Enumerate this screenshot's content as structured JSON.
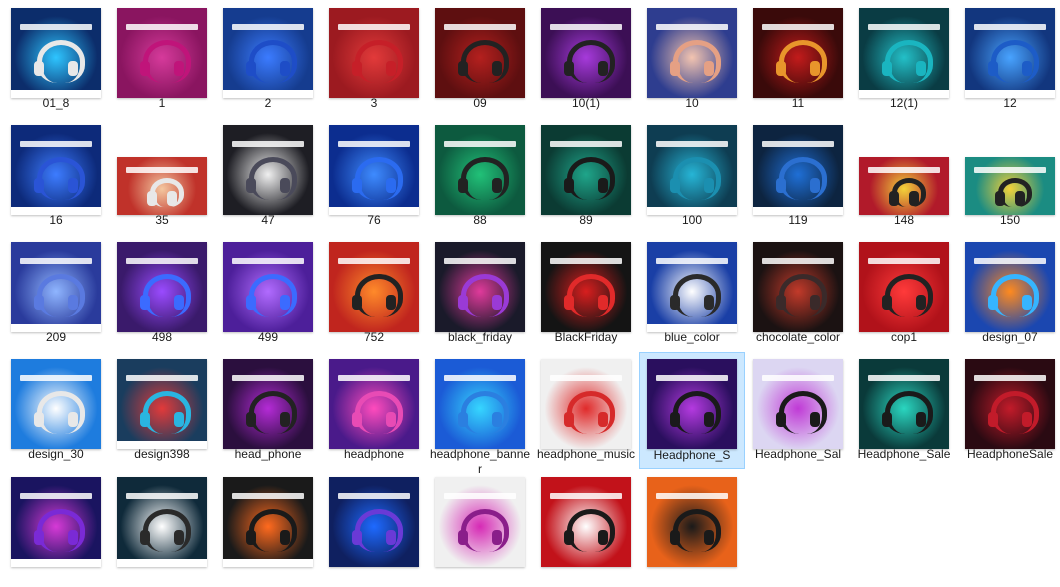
{
  "selected": "Headphone_S",
  "files": [
    {
      "name": "01_8",
      "bg": "#0c2d6b",
      "accent": "#2ec5ff",
      "hp": "#e8e8e8",
      "footer": true,
      "w": 90,
      "h": 90
    },
    {
      "name": "1",
      "bg": "#8a1560",
      "accent": "#d63a9b",
      "hp": "#c0147a",
      "footer": false,
      "w": 90,
      "h": 90
    },
    {
      "name": "2",
      "bg": "#153c8f",
      "accent": "#3b7bff",
      "hp": "#1e4dc7",
      "footer": true,
      "w": 90,
      "h": 90
    },
    {
      "name": "3",
      "bg": "#9c1a20",
      "accent": "#e23a3a",
      "hp": "#c61f28",
      "footer": false,
      "w": 90,
      "h": 90
    },
    {
      "name": "09",
      "bg": "#5e0f10",
      "accent": "#b4201e",
      "hp": "#222222",
      "footer": false,
      "w": 90,
      "h": 90
    },
    {
      "name": "10(1)",
      "bg": "#3c0f55",
      "accent": "#a63adb",
      "hp": "#222222",
      "footer": false,
      "w": 90,
      "h": 90
    },
    {
      "name": "10",
      "bg": "#2e3d8f",
      "accent": "#f3c4b0",
      "hp": "#e5a084",
      "footer": false,
      "w": 90,
      "h": 90
    },
    {
      "name": "11",
      "bg": "#3a0a0a",
      "accent": "#c21b1b",
      "hp": "#e8952b",
      "footer": false,
      "w": 90,
      "h": 90
    },
    {
      "name": "12(1)",
      "bg": "#0a3c44",
      "accent": "#23c0c8",
      "hp": "#1ab5c0",
      "footer": true,
      "w": 90,
      "h": 90
    },
    {
      "name": "12",
      "bg": "#12367e",
      "accent": "#48a3ff",
      "hp": "#1d5cc7",
      "footer": true,
      "w": 90,
      "h": 90
    },
    {
      "name": "16",
      "bg": "#0d2a7a",
      "accent": "#3d7cff",
      "hp": "#2a54d6",
      "footer": true,
      "w": 90,
      "h": 90
    },
    {
      "name": "35",
      "bg": "#c0322a",
      "accent": "#f4c7a0",
      "hp": "#e8e8e8",
      "footer": false,
      "w": 90,
      "h": 58
    },
    {
      "name": "47",
      "bg": "#1e1e24",
      "accent": "#f0f0f0",
      "hp": "#4a4a5a",
      "footer": false,
      "w": 90,
      "h": 90
    },
    {
      "name": "76",
      "bg": "#0c2d8f",
      "accent": "#3e8bff",
      "hp": "#2b6bf0",
      "footer": true,
      "w": 90,
      "h": 90
    },
    {
      "name": "88",
      "bg": "#0d5a3f",
      "accent": "#21c178",
      "hp": "#222222",
      "footer": false,
      "w": 90,
      "h": 90
    },
    {
      "name": "89",
      "bg": "#0b3b33",
      "accent": "#1fa58a",
      "hp": "#1a1a1a",
      "footer": false,
      "w": 90,
      "h": 90
    },
    {
      "name": "100",
      "bg": "#0e3d52",
      "accent": "#26b5d6",
      "hp": "#1b8fb0",
      "footer": true,
      "w": 90,
      "h": 90
    },
    {
      "name": "119",
      "bg": "#0d2440",
      "accent": "#1f6fd6",
      "hp": "#2b6fd0",
      "footer": true,
      "w": 90,
      "h": 90
    },
    {
      "name": "148",
      "bg": "#b11a2a",
      "accent": "#f3d23a",
      "hp": "#222222",
      "footer": false,
      "w": 90,
      "h": 58
    },
    {
      "name": "150",
      "bg": "#1b8c82",
      "accent": "#f3d23a",
      "hp": "#222222",
      "footer": false,
      "w": 90,
      "h": 58
    },
    {
      "name": "209",
      "bg": "#2a3b9c",
      "accent": "#8fb5ff",
      "hp": "#5a7ae0",
      "footer": true,
      "w": 90,
      "h": 90
    },
    {
      "name": "498",
      "bg": "#3a1a6b",
      "accent": "#9a4bff",
      "hp": "#3b6bff",
      "footer": false,
      "w": 90,
      "h": 90
    },
    {
      "name": "499",
      "bg": "#4d1f9a",
      "accent": "#b16bff",
      "hp": "#3b6bff",
      "footer": false,
      "w": 90,
      "h": 90
    },
    {
      "name": "752",
      "bg": "#c0251e",
      "accent": "#ff8a2a",
      "hp": "#222222",
      "footer": false,
      "w": 90,
      "h": 90
    },
    {
      "name": "black_friday",
      "bg": "#1a1a2a",
      "accent": "#e03a9b",
      "hp": "#9a3ad6",
      "footer": false,
      "w": 90,
      "h": 90
    },
    {
      "name": "BlackFriday",
      "bg": "#141414",
      "accent": "#d81e1e",
      "hp": "#e12a2a",
      "footer": false,
      "w": 90,
      "h": 90
    },
    {
      "name": "blue_color",
      "bg": "#1a3fa6",
      "accent": "#ffffff",
      "hp": "#2a2a2a",
      "footer": true,
      "w": 90,
      "h": 90
    },
    {
      "name": "chocolate_color",
      "bg": "#1b1212",
      "accent": "#c23a2a",
      "hp": "#3a2a2a",
      "footer": false,
      "w": 90,
      "h": 90
    },
    {
      "name": "cop1",
      "bg": "#b1121a",
      "accent": "#ff3a3a",
      "hp": "#222222",
      "footer": false,
      "w": 90,
      "h": 90
    },
    {
      "name": "design_07",
      "bg": "#1b47b0",
      "accent": "#ff8a1e",
      "hp": "#36b5ff",
      "footer": false,
      "w": 90,
      "h": 90
    },
    {
      "name": "design_30",
      "bg": "#1e7cde",
      "accent": "#ffffff",
      "hp": "#e8e8e8",
      "footer": false,
      "w": 90,
      "h": 90
    },
    {
      "name": "design398",
      "bg": "#1a3d5e",
      "accent": "#e23a3a",
      "hp": "#2ab5e0",
      "footer": true,
      "w": 90,
      "h": 90
    },
    {
      "name": "head_phone",
      "bg": "#2b0f3e",
      "accent": "#b42bd6",
      "hp": "#222222",
      "footer": false,
      "w": 90,
      "h": 90
    },
    {
      "name": "headphone",
      "bg": "#4a1a8a",
      "accent": "#ff4bbd",
      "hp": "#e84bb5",
      "footer": false,
      "w": 90,
      "h": 90
    },
    {
      "name": "headphone_banner",
      "bg": "#1b5bd6",
      "accent": "#36d6ff",
      "hp": "#2b7fe0",
      "footer": false,
      "w": 90,
      "h": 90
    },
    {
      "name": "headphone_music",
      "bg": "#f0f0f0",
      "accent": "#e02a2a",
      "hp": "#d62a2a",
      "footer": false,
      "w": 90,
      "h": 90
    },
    {
      "name": "Headphone_S",
      "bg": "#2a0f5e",
      "accent": "#b43ae0",
      "hp": "#1a1a1a",
      "footer": false,
      "w": 90,
      "h": 90
    },
    {
      "name": "Headphone_Sal",
      "bg": "#dcd6f2",
      "accent": "#c03ad6",
      "hp": "#1a1a1a",
      "footer": false,
      "w": 90,
      "h": 90
    },
    {
      "name": "Headphone_Sale",
      "bg": "#0a3a3a",
      "accent": "#2ad6c0",
      "hp": "#1a1a1a",
      "footer": false,
      "w": 90,
      "h": 90
    },
    {
      "name": "HeadphoneSale",
      "bg": "#2a0a12",
      "accent": "#c21b2a",
      "hp": "#c21b2a",
      "footer": false,
      "w": 90,
      "h": 90
    },
    {
      "name": "",
      "bg": "#1a1460",
      "accent": "#d63ad6",
      "hp": "#7a2ad6",
      "footer": true,
      "w": 90,
      "h": 90
    },
    {
      "name": "",
      "bg": "#0f2a3a",
      "accent": "#ffffff",
      "hp": "#2a2a2a",
      "footer": true,
      "w": 90,
      "h": 90
    },
    {
      "name": "",
      "bg": "#1a1a1a",
      "accent": "#ff6a1e",
      "hp": "#1a1a1a",
      "footer": true,
      "w": 90,
      "h": 90
    },
    {
      "name": "",
      "bg": "#0f2060",
      "accent": "#1e6aff",
      "hp": "#6a3ad6",
      "footer": false,
      "w": 90,
      "h": 90
    },
    {
      "name": "",
      "bg": "#f0f0f0",
      "accent": "#d62ab5",
      "hp": "#8a1e8a",
      "footer": false,
      "w": 90,
      "h": 90
    },
    {
      "name": "",
      "bg": "#c2121a",
      "accent": "#ffffff",
      "hp": "#1a1a1a",
      "footer": false,
      "w": 90,
      "h": 90
    },
    {
      "name": "",
      "bg": "#e8621a",
      "accent": "#1a1a1a",
      "hp": "#1a1a1a",
      "footer": false,
      "w": 90,
      "h": 90
    }
  ]
}
